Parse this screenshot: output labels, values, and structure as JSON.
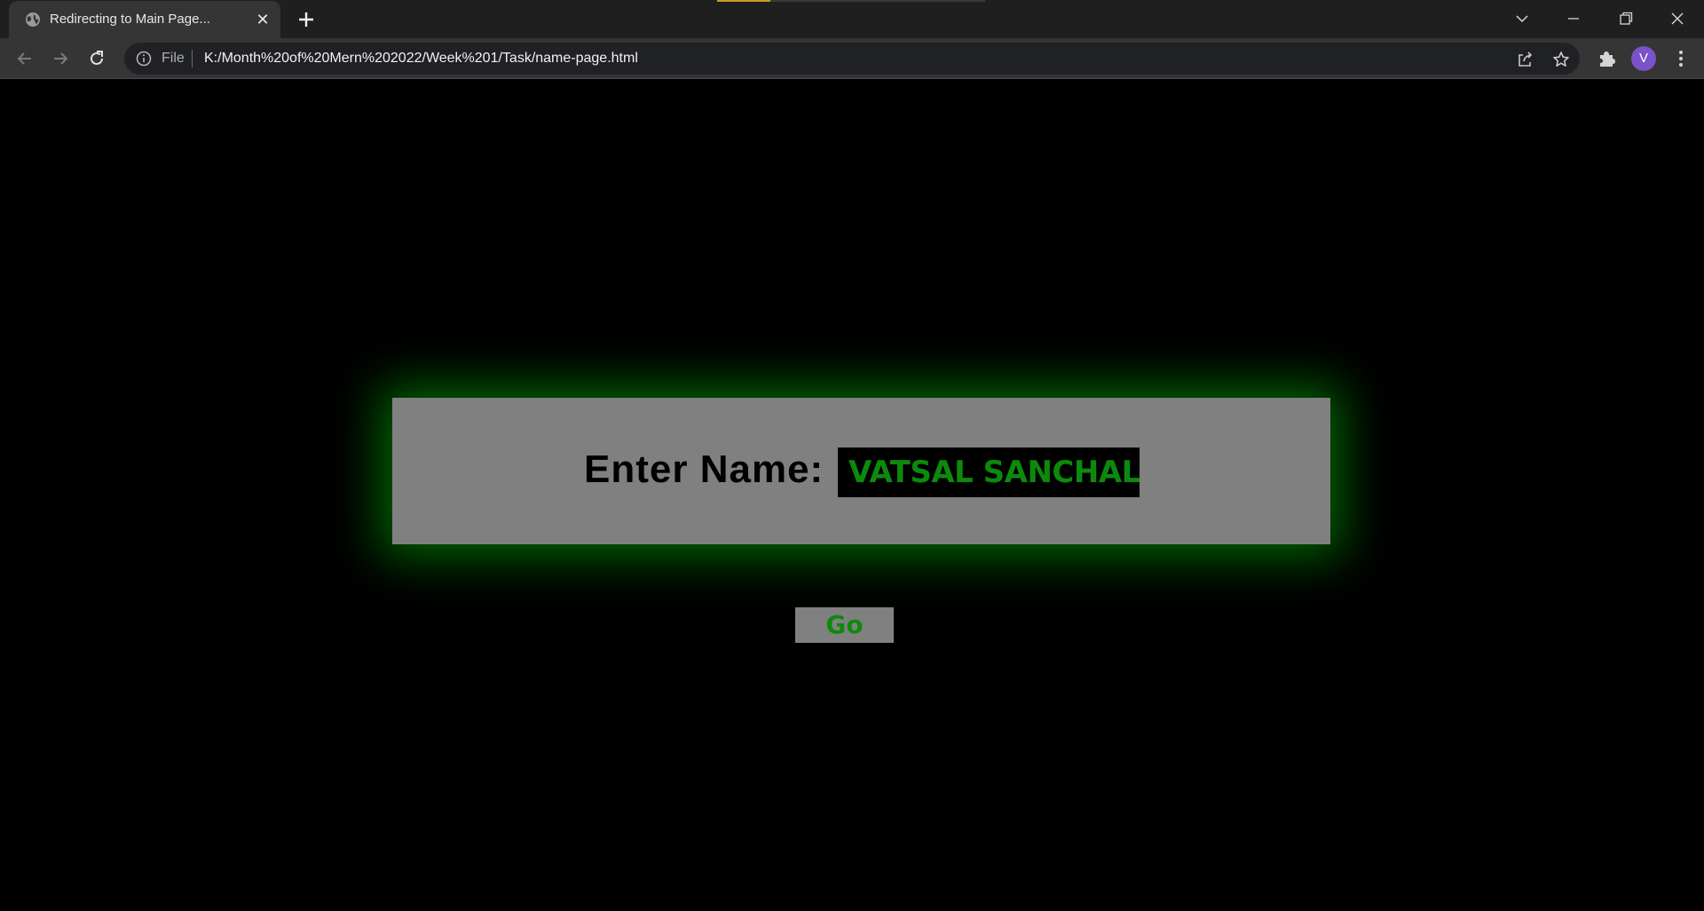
{
  "browser": {
    "tab": {
      "title": "Redirecting to Main Page...",
      "favicon": "globe-icon"
    },
    "new_tab_icon": "plus-icon",
    "window_controls": [
      "tab-search-icon",
      "minimize-icon",
      "restore-icon",
      "close-icon"
    ],
    "omnibox": {
      "scheme_label": "File",
      "url": "K:/Month%20of%20Mern%202022/Week%201/Task/name-page.html"
    },
    "profile_initial": "V",
    "colors": {
      "avatar": "#7b52c9",
      "loading_bar": "#c99a2e"
    }
  },
  "page": {
    "form": {
      "label": "Enter Name:",
      "name_value": "VATSAL SANCHALA",
      "submit_label": "Go"
    },
    "colors": {
      "background": "#000000",
      "card": "#808080",
      "glow": "#00b400",
      "accent_text": "#0c8a0c"
    }
  }
}
